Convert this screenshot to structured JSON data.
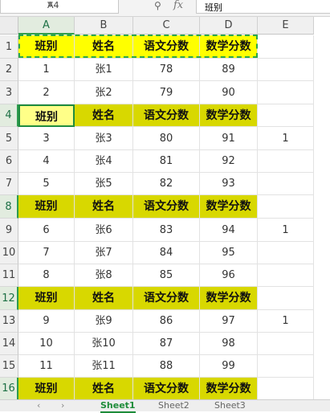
{
  "formula_bar": {
    "name_box": "A4",
    "zoom_icon": "zoom-icon",
    "fx_label": "fx",
    "formula_value": "班别"
  },
  "columns": [
    "A",
    "B",
    "C",
    "D",
    "E"
  ],
  "active_column": "A",
  "active_row": "4",
  "header_labels": [
    "班别",
    "姓名",
    "语文分数",
    "数学分数"
  ],
  "rows": [
    {
      "num": "1",
      "type": "header",
      "cells": [
        "班别",
        "姓名",
        "语文分数",
        "数学分数",
        ""
      ]
    },
    {
      "num": "2",
      "type": "data",
      "cells": [
        "1",
        "张1",
        "78",
        "89",
        ""
      ]
    },
    {
      "num": "3",
      "type": "data",
      "cells": [
        "2",
        "张2",
        "79",
        "90",
        ""
      ]
    },
    {
      "num": "4",
      "type": "header",
      "cells": [
        "班别",
        "姓名",
        "语文分数",
        "数学分数",
        ""
      ]
    },
    {
      "num": "5",
      "type": "data",
      "cells": [
        "3",
        "张3",
        "80",
        "91",
        "1"
      ]
    },
    {
      "num": "6",
      "type": "data",
      "cells": [
        "4",
        "张4",
        "81",
        "92",
        ""
      ]
    },
    {
      "num": "7",
      "type": "data",
      "cells": [
        "5",
        "张5",
        "82",
        "93",
        ""
      ]
    },
    {
      "num": "8",
      "type": "header",
      "cells": [
        "班别",
        "姓名",
        "语文分数",
        "数学分数",
        ""
      ]
    },
    {
      "num": "9",
      "type": "data",
      "cells": [
        "6",
        "张6",
        "83",
        "94",
        "1"
      ]
    },
    {
      "num": "10",
      "type": "data",
      "cells": [
        "7",
        "张7",
        "84",
        "95",
        ""
      ]
    },
    {
      "num": "11",
      "type": "data",
      "cells": [
        "8",
        "张8",
        "85",
        "96",
        ""
      ]
    },
    {
      "num": "12",
      "type": "header",
      "cells": [
        "班别",
        "姓名",
        "语文分数",
        "数学分数",
        ""
      ]
    },
    {
      "num": "13",
      "type": "data",
      "cells": [
        "9",
        "张9",
        "86",
        "97",
        "1"
      ]
    },
    {
      "num": "14",
      "type": "data",
      "cells": [
        "10",
        "张10",
        "87",
        "98",
        ""
      ]
    },
    {
      "num": "15",
      "type": "data",
      "cells": [
        "11",
        "张11",
        "88",
        "99",
        ""
      ]
    },
    {
      "num": "16",
      "type": "header",
      "cells": [
        "班别",
        "姓名",
        "语文分数",
        "数学分数",
        ""
      ]
    }
  ],
  "sheet_tabs": [
    "Sheet1",
    "Sheet2",
    "Sheet3"
  ],
  "active_sheet": "Sheet1",
  "colors": {
    "header_fill": "#d8d800",
    "header_fill_row1": "#ffff00",
    "selection": "#1f8c3f"
  }
}
